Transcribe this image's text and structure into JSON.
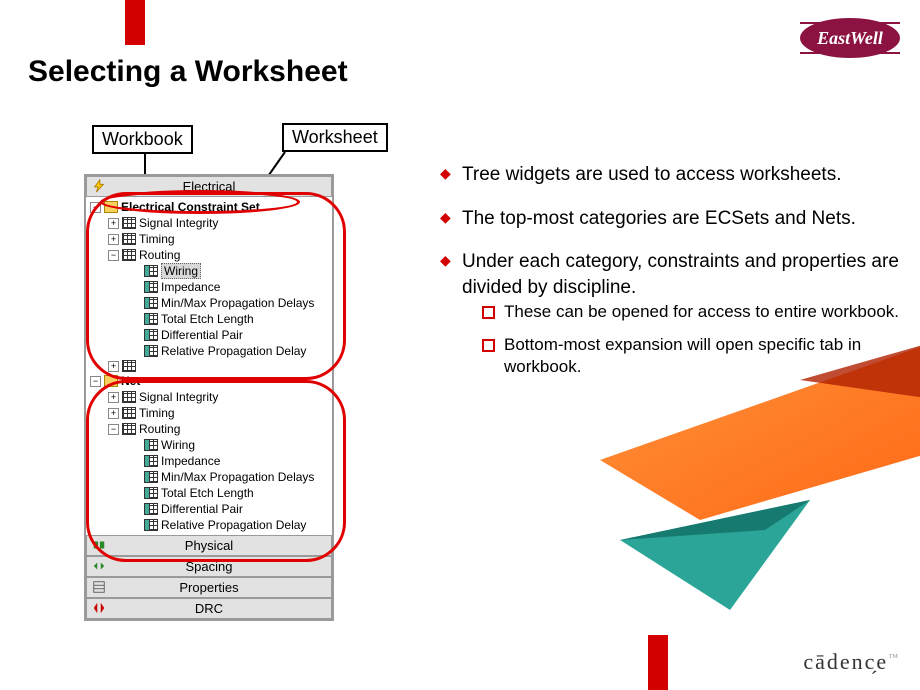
{
  "brand": {
    "eastwell": "EastWell",
    "cadence": "cādenc̗e"
  },
  "title": "Selecting a Worksheet",
  "callouts": {
    "workbook": "Workbook",
    "worksheet": "Worksheet"
  },
  "panel": {
    "sections": {
      "electrical": "Electrical",
      "physical": "Physical",
      "spacing": "Spacing",
      "properties": "Properties",
      "drc": "DRC"
    },
    "tree": {
      "ecs": {
        "label": "Electrical Constraint Set",
        "children": {
          "si": "Signal Integrity",
          "timing": "Timing",
          "routing": {
            "label": "Routing",
            "children": {
              "wiring": "Wiring",
              "impedance": "Impedance",
              "mmpd": "Min/Max Propagation Delays",
              "tel": "Total Etch Length",
              "dp": "Differential Pair",
              "rpd": "Relative Propagation Delay"
            }
          }
        }
      },
      "net": {
        "label": "Net",
        "children": {
          "si": "Signal Integrity",
          "timing": "Timing",
          "routing": {
            "label": "Routing",
            "children": {
              "wiring": "Wiring",
              "impedance": "Impedance",
              "mmpd": "Min/Max Propagation Delays",
              "tel": "Total Etch Length",
              "dp": "Differential Pair",
              "rpd": "Relative Propagation Delay"
            }
          }
        }
      }
    }
  },
  "bullets": {
    "b1": "Tree widgets are used to access worksheets.",
    "b2": "The top-most categories are ECSets and Nets.",
    "b3": "Under each category, constraints and properties are divided by discipline.",
    "s1": "These can be opened for access to entire workbook.",
    "s2": "Bottom-most expansion will open specific tab in workbook."
  }
}
